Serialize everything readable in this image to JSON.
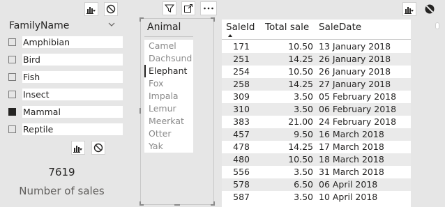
{
  "family_slicer": {
    "header": "FamilyName",
    "items": [
      {
        "label": "Amphibian",
        "checked": false
      },
      {
        "label": "Bird",
        "checked": false
      },
      {
        "label": "Fish",
        "checked": false
      },
      {
        "label": "Insect",
        "checked": false
      },
      {
        "label": "Mammal",
        "checked": true
      },
      {
        "label": "Reptile",
        "checked": false
      }
    ]
  },
  "card": {
    "value": "7619",
    "label": "Number of sales"
  },
  "animal_slicer": {
    "header": "Animal",
    "items": [
      {
        "label": "Camel",
        "selected": false
      },
      {
        "label": "Dachsund",
        "selected": false
      },
      {
        "label": "Elephant",
        "selected": true
      },
      {
        "label": "Fox",
        "selected": false
      },
      {
        "label": "Impala",
        "selected": false
      },
      {
        "label": "Lemur",
        "selected": false
      },
      {
        "label": "Meerkat",
        "selected": false
      },
      {
        "label": "Otter",
        "selected": false
      },
      {
        "label": "Yak",
        "selected": false
      }
    ]
  },
  "table": {
    "columns": [
      "SaleId",
      "Total sale",
      "SaleDate"
    ],
    "rows": [
      [
        "171",
        "10.50",
        "13 January 2018"
      ],
      [
        "251",
        "14.25",
        "26 January 2018"
      ],
      [
        "254",
        "10.50",
        "26 January 2018"
      ],
      [
        "258",
        "14.25",
        "27 January 2018"
      ],
      [
        "309",
        "3.50",
        "05 February 2018"
      ],
      [
        "310",
        "3.50",
        "06 February 2018"
      ],
      [
        "383",
        "21.00",
        "24 February 2018"
      ],
      [
        "457",
        "9.50",
        "16 March 2018"
      ],
      [
        "478",
        "14.25",
        "17 March 2018"
      ],
      [
        "480",
        "10.50",
        "18 March 2018"
      ],
      [
        "556",
        "3.50",
        "31 March 2018"
      ],
      [
        "578",
        "6.50",
        "06 April 2018"
      ],
      [
        "587",
        "3.50",
        "10 April 2018"
      ]
    ]
  },
  "icons": {
    "visual_filter": "bar-chart-filter-icon",
    "no_filter": "prohibited-icon",
    "filter": "funnel-icon",
    "focus": "focus-mode-icon",
    "more": "more-options-icon"
  }
}
